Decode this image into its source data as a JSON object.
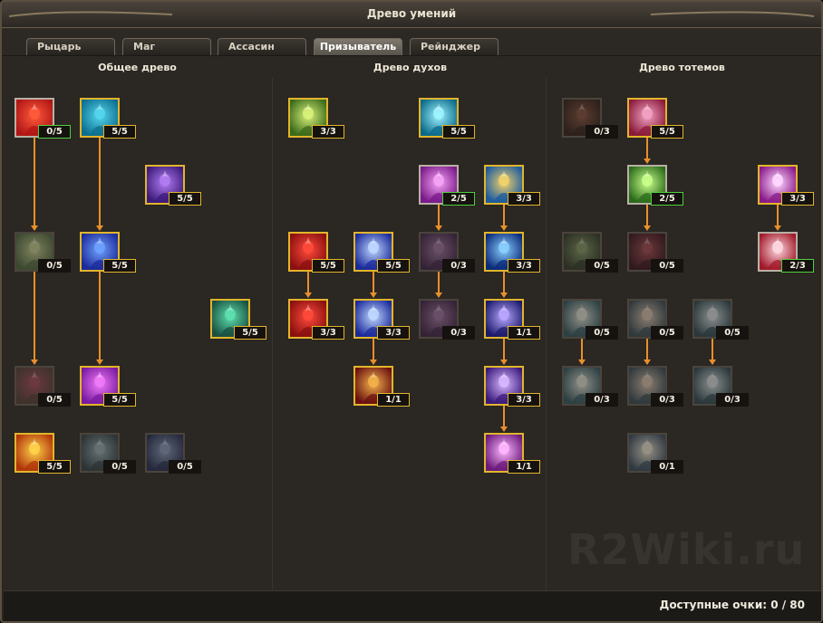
{
  "window": {
    "title": "Древо умений"
  },
  "tabs": [
    {
      "label": "Рыцарь",
      "active": false
    },
    {
      "label": "Маг",
      "active": false
    },
    {
      "label": "Ассасин",
      "active": false
    },
    {
      "label": "Призыватель",
      "active": true
    },
    {
      "label": "Рейнджер",
      "active": false
    }
  ],
  "columns": [
    {
      "title": "Общее древо"
    },
    {
      "title": "Древо духов"
    },
    {
      "title": "Древо тотемов"
    }
  ],
  "skills": {
    "general": [
      {
        "name": "red-figure",
        "rank": "0/5",
        "state": "avail-zero",
        "colors": [
          "#b01616",
          "#ff5a3a"
        ]
      },
      {
        "name": "cyan-figure",
        "rank": "5/5",
        "state": "maxed",
        "colors": [
          "#0d6f8f",
          "#55d6ee"
        ]
      },
      {
        "name": "purple-figure",
        "rank": "5/5",
        "state": "maxed",
        "colors": [
          "#3b1a7a",
          "#b27cf2"
        ]
      },
      {
        "name": "green-cross",
        "rank": "0/5",
        "state": "locked",
        "colors": [
          "#3f6b2a",
          "#c4d36a"
        ]
      },
      {
        "name": "blue-orbs",
        "rank": "5/5",
        "state": "maxed",
        "colors": [
          "#1c2a9a",
          "#6fa2ff"
        ]
      },
      {
        "name": "green-stone",
        "rank": "5/5",
        "state": "maxed",
        "colors": [
          "#1a5040",
          "#5ee0b0"
        ]
      },
      {
        "name": "red-cross",
        "rank": "0/5",
        "state": "locked",
        "colors": [
          "#5a3a2a",
          "#d23a5a"
        ]
      },
      {
        "name": "violet-orbs",
        "rank": "5/5",
        "state": "maxed",
        "colors": [
          "#7a1aa0",
          "#f07af8"
        ]
      },
      {
        "name": "fire-sigil",
        "rank": "5/5",
        "state": "maxed",
        "colors": [
          "#b0360a",
          "#ffd24a"
        ]
      },
      {
        "name": "grey-tree",
        "rank": "0/5",
        "state": "locked",
        "colors": [
          "#26404a",
          "#8ab0bc"
        ]
      },
      {
        "name": "blue-tree",
        "rank": "0/5",
        "state": "locked",
        "colors": [
          "#1a2a6a",
          "#7e9ed6"
        ]
      }
    ],
    "spirits": [
      {
        "name": "green-spirit",
        "rank": "3/3",
        "state": "maxed",
        "colors": [
          "#3a6a1a",
          "#d8f27a"
        ]
      },
      {
        "name": "cyan-wave",
        "rank": "5/5",
        "state": "maxed",
        "colors": [
          "#0a6a8a",
          "#9ff4ff"
        ]
      },
      {
        "name": "violet-lotus",
        "rank": "2/5",
        "state": "partial",
        "colors": [
          "#7a1a8a",
          "#f6a2f4"
        ]
      },
      {
        "name": "sky-burst",
        "rank": "3/3",
        "state": "maxed",
        "colors": [
          "#1a5aa0",
          "#f2d26a"
        ]
      },
      {
        "name": "red-brute",
        "rank": "5/5",
        "state": "maxed",
        "colors": [
          "#8a1010",
          "#ff4a3a"
        ]
      },
      {
        "name": "ice-tree",
        "rank": "5/5",
        "state": "maxed",
        "colors": [
          "#1a2a9a",
          "#c0d8ff"
        ]
      },
      {
        "name": "dim-lotus",
        "rank": "0/3",
        "state": "locked",
        "colors": [
          "#4a1a5a",
          "#b26ab8"
        ]
      },
      {
        "name": "blue-warrior",
        "rank": "3/3",
        "state": "maxed",
        "colors": [
          "#0a2a7a",
          "#8ad0ff"
        ]
      },
      {
        "name": "red-brute-2",
        "rank": "3/3",
        "state": "maxed",
        "colors": [
          "#8a1010",
          "#ff4a3a"
        ]
      },
      {
        "name": "ice-tree-2",
        "rank": "3/3",
        "state": "maxed",
        "colors": [
          "#1a2a9a",
          "#c0d8ff"
        ]
      },
      {
        "name": "dim-lotus-2",
        "rank": "0/3",
        "state": "locked",
        "colors": [
          "#4a1a5a",
          "#b26ab8"
        ]
      },
      {
        "name": "triad-1",
        "rank": "1/1",
        "state": "maxed",
        "colors": [
          "#1a1a6a",
          "#b8a6ff"
        ]
      },
      {
        "name": "hooded-mage",
        "rank": "1/1",
        "state": "maxed",
        "colors": [
          "#6a1010",
          "#f2b24a"
        ]
      },
      {
        "name": "triad-2",
        "rank": "3/3",
        "state": "maxed",
        "colors": [
          "#3a1a7a",
          "#d8b6ff"
        ]
      },
      {
        "name": "triad-3",
        "rank": "1/1",
        "state": "maxed",
        "colors": [
          "#6a1a7a",
          "#ffb6ff"
        ]
      }
    ],
    "totems": [
      {
        "name": "dark-totem",
        "rank": "0/3",
        "state": "locked",
        "colors": [
          "#3a1a10",
          "#a04a2a"
        ]
      },
      {
        "name": "pink-totem",
        "rank": "5/5",
        "state": "maxed",
        "colors": [
          "#8a1a3a",
          "#f2a2c4"
        ]
      },
      {
        "name": "green-glow",
        "rank": "2/5",
        "state": "partial",
        "colors": [
          "#2a6a1a",
          "#c8ff8a"
        ]
      },
      {
        "name": "pink-face",
        "rank": "3/3",
        "state": "maxed",
        "colors": [
          "#8a1a8a",
          "#ffd8ff"
        ]
      },
      {
        "name": "green-beast",
        "rank": "0/5",
        "state": "locked",
        "colors": [
          "#2a3a1a",
          "#7aa04a"
        ]
      },
      {
        "name": "blood-drop",
        "rank": "0/5",
        "state": "locked",
        "colors": [
          "#4a0a1a",
          "#d03a4a"
        ]
      },
      {
        "name": "skull-bloom",
        "rank": "2/3",
        "state": "partial",
        "colors": [
          "#a01a2a",
          "#ffd8e0"
        ]
      },
      {
        "name": "stone-idol",
        "rank": "0/5",
        "state": "locked",
        "colors": [
          "#1a5a6a",
          "#e2e6d0"
        ]
      },
      {
        "name": "winged-idol",
        "rank": "0/5",
        "state": "locked",
        "colors": [
          "#2a4a5a",
          "#e6c2a0"
        ]
      },
      {
        "name": "spire-idol",
        "rank": "0/5",
        "state": "locked",
        "colors": [
          "#1a4a5a",
          "#d8e4e8"
        ]
      },
      {
        "name": "stone-idol-2",
        "rank": "0/3",
        "state": "locked",
        "colors": [
          "#1a5a6a",
          "#e2e6d0"
        ]
      },
      {
        "name": "winged-idol-2",
        "rank": "0/3",
        "state": "locked",
        "colors": [
          "#2a4a5a",
          "#e6c2a0"
        ]
      },
      {
        "name": "spire-idol-2",
        "rank": "0/3",
        "state": "locked",
        "colors": [
          "#1a4a5a",
          "#d8e4e8"
        ]
      },
      {
        "name": "horned-idol",
        "rank": "0/1",
        "state": "locked",
        "colors": [
          "#2a4a6a",
          "#f0e8c8"
        ]
      }
    ]
  },
  "footer": {
    "points": "Доступные очки: 0 / 80"
  },
  "watermark": "R2Wiki.ru",
  "colors": {
    "accent_gold": "#e2b52b",
    "available_green": "#4fcf3c",
    "link_orange": "#e8902a"
  }
}
